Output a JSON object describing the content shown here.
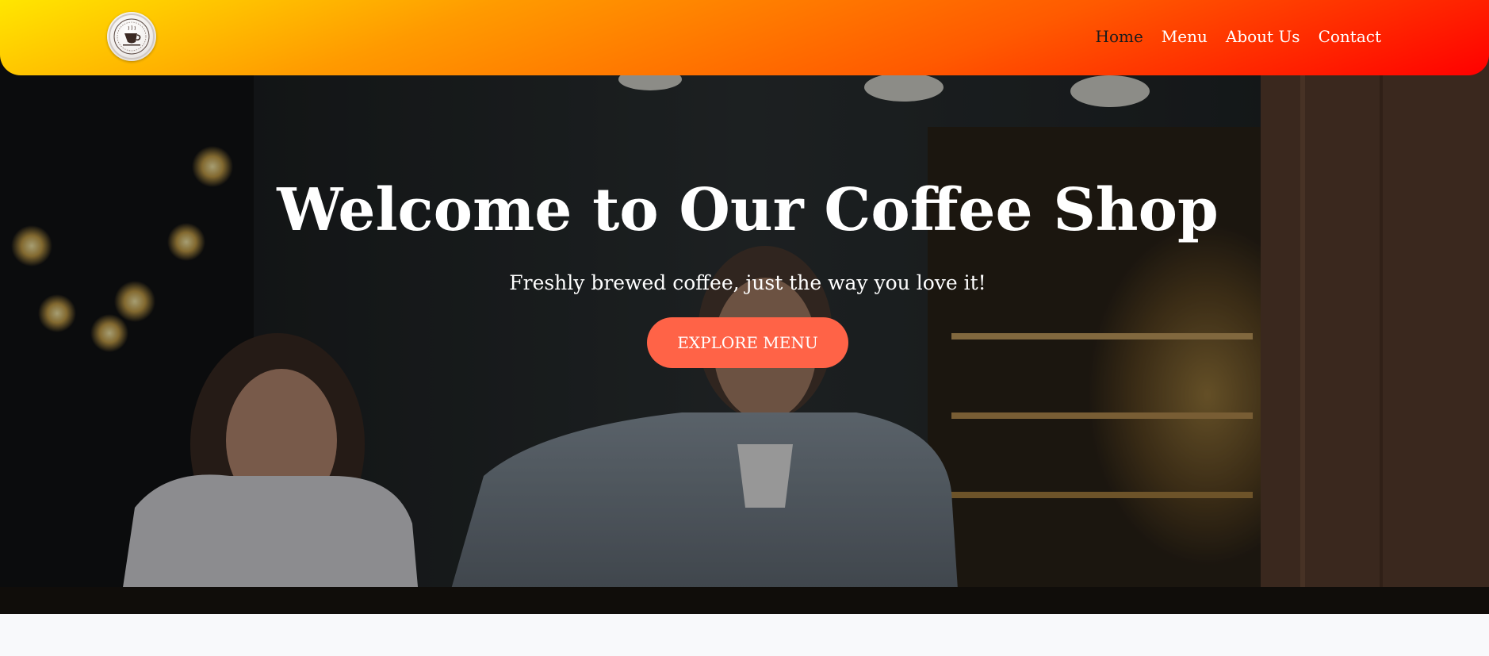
{
  "header": {
    "logo_alt": "Coffee shop logo",
    "nav": [
      {
        "label": "Home",
        "active": true
      },
      {
        "label": "Menu",
        "active": false
      },
      {
        "label": "About Us",
        "active": false
      },
      {
        "label": "Contact",
        "active": false
      }
    ],
    "gradient_colors": [
      "#ffe600",
      "#ff9a00",
      "#ff5a00",
      "#ff0000"
    ]
  },
  "hero": {
    "title": "Welcome to Our Coffee Shop",
    "subtitle": "Freshly brewed coffee, just the way you love it!",
    "cta_label": "EXPLORE MENU",
    "cta_color": "#ff6347",
    "background_description_icon": "cafe-photo"
  }
}
